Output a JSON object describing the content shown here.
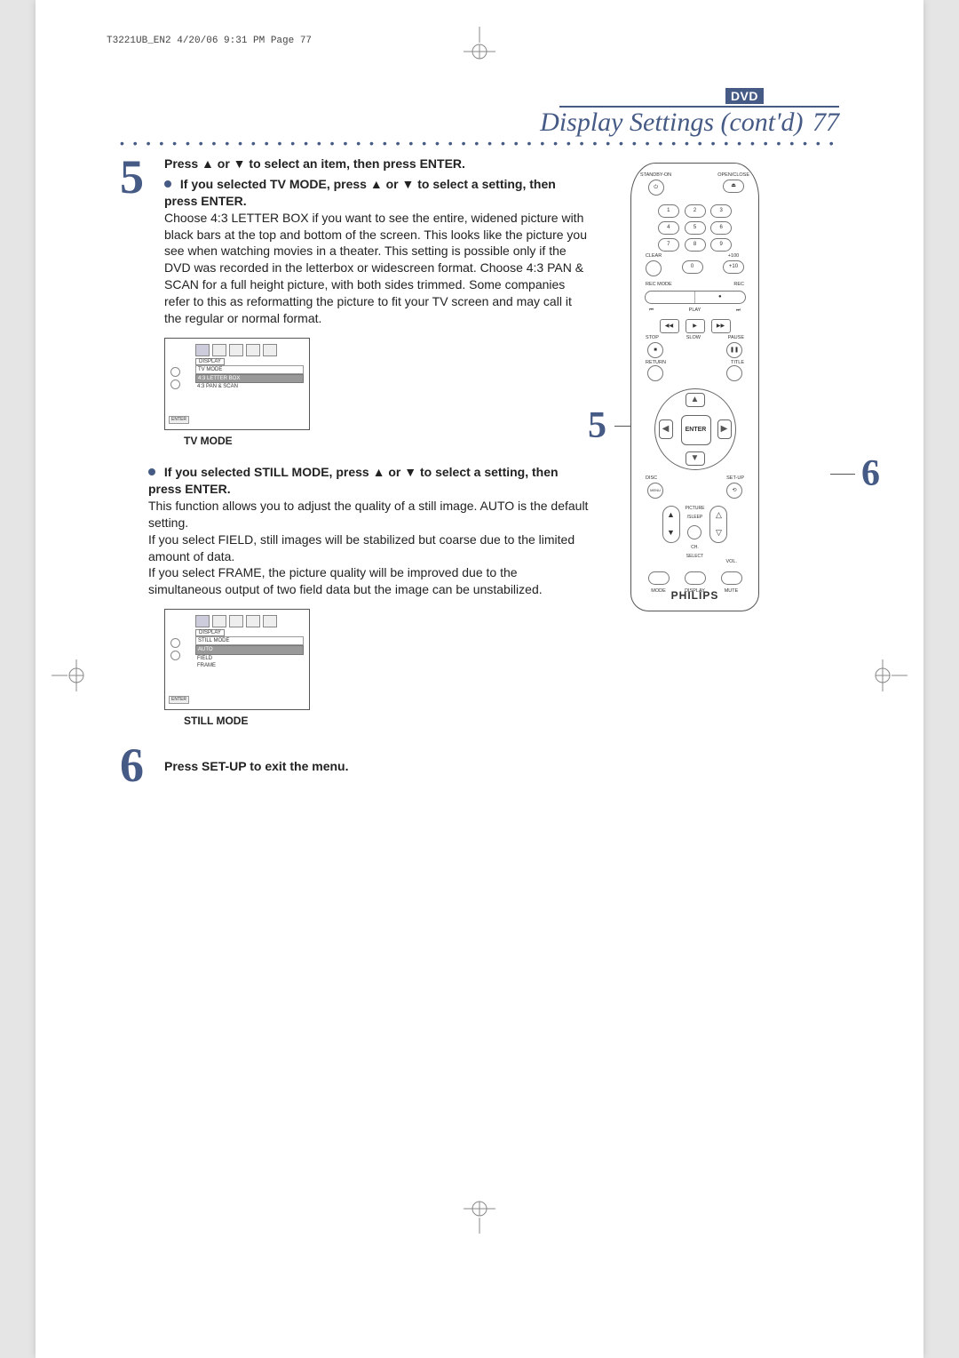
{
  "meta_header": "T3221UB_EN2  4/20/06  9:31 PM  Page 77",
  "badge": "DVD",
  "title": "Display Settings (cont'd)",
  "page_num": "77",
  "step5": {
    "num": "5",
    "head": "Press ▲ or ▼ to select an item, then press ENTER.",
    "sub1_bold": "If you selected TV MODE, press ▲ or ▼ to select a setting, then press ENTER.",
    "para1": "Choose 4:3 LETTER BOX if you want to see the entire, widened picture with black bars at the top and bottom of the screen.  This looks like the picture you see when watching movies in a theater. This setting is possible only if the DVD was recorded in the letterbox or widescreen format. Choose 4:3 PAN & SCAN for a full height picture, with both sides trimmed.  Some companies refer to this as reformatting the picture to fit your TV screen and may call it the regular or normal format.",
    "menu1": {
      "title": "DISPLAY",
      "group": "TV MODE",
      "opt_hl": "4:3 LETTER BOX",
      "opt2": "4:3 PAN & SCAN",
      "enter": "ENTER"
    },
    "cap1": "TV MODE",
    "sub2_bold": "If you selected STILL MODE, press ▲ or ▼ to select a setting, then press ENTER.",
    "para2a": "This function allows you to adjust the quality of a still image.  AUTO is the default setting.",
    "para2b": "If you select FIELD, still images will be stabilized but coarse due to the limited amount of data.",
    "para2c": "If you select FRAME, the picture quality will be improved due to the simultaneous output of two field data but the image can be unstabilized.",
    "menu2": {
      "title": "DISPLAY",
      "group": "STILL MODE",
      "opt_hl": "AUTO",
      "opt2": "FIELD",
      "opt3": "FRAME",
      "enter": "ENTER"
    },
    "cap2": "STILL MODE"
  },
  "step6": {
    "num": "6",
    "head": "Press SET-UP to exit the menu."
  },
  "remote": {
    "standby": "STANDBY-ON",
    "openclose": "OPEN/CLOSE",
    "clear": "CLEAR",
    "plus100": "+100",
    "plus10": "+10",
    "recmode": "REC MODE",
    "rec": "REC",
    "play": "PLAY",
    "stop": "STOP",
    "slow": "SLOW",
    "pause": "PAUSE",
    "return": "RETURN",
    "title_btn": "TITLE",
    "enter": "ENTER",
    "disc": "DISC",
    "menu": "MENU",
    "setup": "SET-UP",
    "picture": "PICTURE",
    "sleep": "/SLEEP",
    "ch": "CH.",
    "vol": "VOL.",
    "select": "SELECT",
    "mode": "MODE",
    "display": "DISPLAY",
    "mute": "MUTE",
    "brand": "PHILIPS",
    "k1": "1",
    "k2": "2",
    "k3": "3",
    "k4": "4",
    "k5": "5",
    "k6": "6",
    "k7": "7",
    "k8": "8",
    "k9": "9",
    "k0": "0"
  },
  "callout5": "5",
  "callout6": "6"
}
